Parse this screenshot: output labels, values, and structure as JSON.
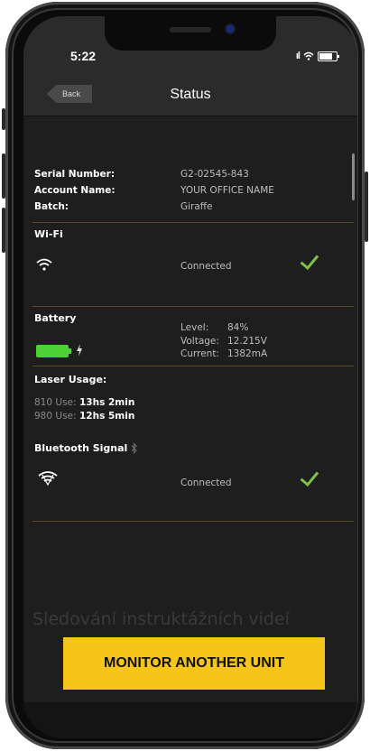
{
  "statusbar": {
    "time": "5:22",
    "signal_glyph": "ıl"
  },
  "navbar": {
    "back_label": "Back",
    "title": "Status"
  },
  "device": {
    "serial_label": "Serial Number:",
    "serial_value": "G2-02545-843",
    "account_label": "Account Name:",
    "account_value": "YOUR OFFICE NAME",
    "batch_label": "Batch:",
    "batch_value": "Giraffe"
  },
  "wifi": {
    "title": "Wi-Fi",
    "status": "Connected"
  },
  "battery": {
    "title": "Battery",
    "level_label": "Level:",
    "level_value": "84%",
    "voltage_label": "Voltage:",
    "voltage_value": "12.215V",
    "current_label": "Current:",
    "current_value": "1382mA"
  },
  "laser": {
    "title": "Laser Usage:",
    "use1_label": "810 Use:",
    "use1_value": "13hs 2min",
    "use2_label": "980 Use:",
    "use2_value": "12hs 5min"
  },
  "bluetooth": {
    "title": "Bluetooth Signal",
    "status": "Connected"
  },
  "overlay": {
    "text": "Sledování instruktážních videí"
  },
  "cta": {
    "label": "MONITOR ANOTHER UNIT"
  },
  "colors": {
    "accent": "#f5c518",
    "ok_green": "#7cc24a",
    "battery_green": "#4cd137"
  },
  "icons": [
    "wifi-icon",
    "battery-icon",
    "charging-bolt-icon",
    "bluetooth-icon",
    "bluetooth-signal-icon",
    "check-icon"
  ]
}
